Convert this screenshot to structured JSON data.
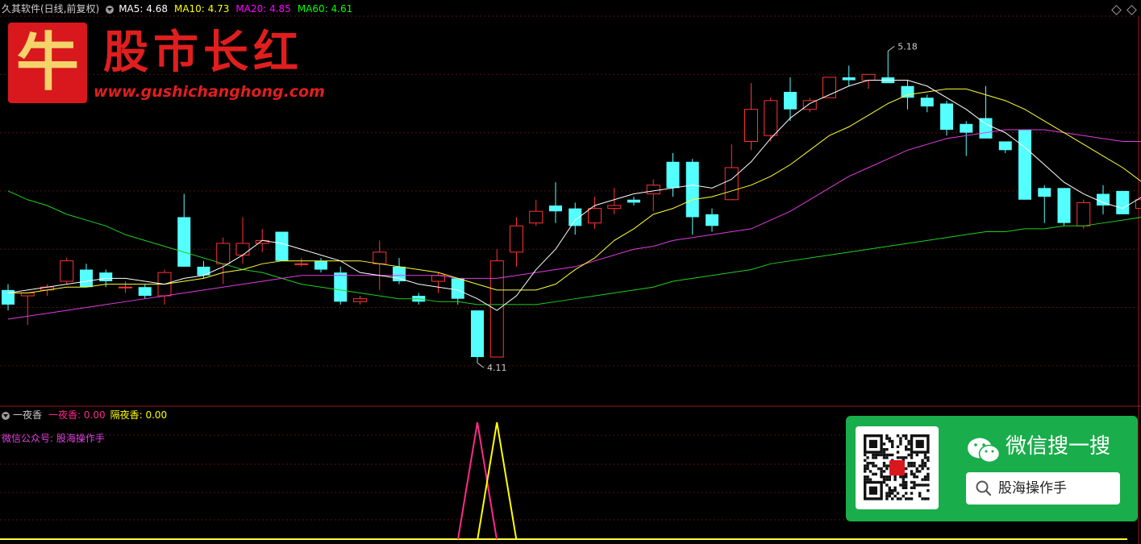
{
  "header": {
    "title": "久其软件(日线,前复权)",
    "indicators": [
      {
        "label": "MA5:",
        "value": "4.68",
        "color": "#ffffff"
      },
      {
        "label": "MA10:",
        "value": "4.73",
        "color": "#ffff00"
      },
      {
        "label": "MA20:",
        "value": "4.85",
        "color": "#ff00ff"
      },
      {
        "label": "MA60:",
        "value": "4.61",
        "color": "#00ff00"
      }
    ]
  },
  "chart_data": {
    "type": "candlestick",
    "price_range": [
      4.0,
      5.3
    ],
    "high_label": "5.18",
    "low_label": "4.11",
    "candles": [
      [
        4.36,
        4.31,
        4.38,
        4.29
      ],
      [
        4.34,
        4.35,
        4.35,
        4.24
      ],
      [
        4.36,
        4.37,
        4.38,
        4.34
      ],
      [
        4.39,
        4.46,
        4.47,
        4.38
      ],
      [
        4.43,
        4.37,
        4.45,
        4.37
      ],
      [
        4.42,
        4.39,
        4.43,
        4.37
      ],
      [
        4.37,
        4.37,
        4.39,
        4.35
      ],
      [
        4.37,
        4.34,
        4.38,
        4.33
      ],
      [
        4.34,
        4.42,
        4.43,
        4.31
      ],
      [
        4.61,
        4.44,
        4.69,
        4.44
      ],
      [
        4.44,
        4.41,
        4.46,
        4.4
      ],
      [
        4.45,
        4.52,
        4.54,
        4.38
      ],
      [
        4.48,
        4.52,
        4.61,
        4.45
      ],
      [
        4.52,
        4.53,
        4.57,
        4.49
      ],
      [
        4.56,
        4.46,
        4.56,
        4.46
      ],
      [
        4.45,
        4.45,
        4.47,
        4.44
      ],
      [
        4.46,
        4.43,
        4.47,
        4.42
      ],
      [
        4.42,
        4.32,
        4.44,
        4.31
      ],
      [
        4.32,
        4.33,
        4.34,
        4.31
      ],
      [
        4.45,
        4.49,
        4.53,
        4.36
      ],
      [
        4.44,
        4.39,
        4.47,
        4.38
      ],
      [
        4.34,
        4.32,
        4.35,
        4.31
      ],
      [
        4.39,
        4.41,
        4.42,
        4.35
      ],
      [
        4.4,
        4.33,
        4.4,
        4.31
      ],
      [
        4.29,
        4.13,
        4.29,
        4.11
      ],
      [
        4.13,
        4.46,
        4.5,
        4.13
      ],
      [
        4.49,
        4.58,
        4.61,
        4.44
      ],
      [
        4.59,
        4.63,
        4.67,
        4.58
      ],
      [
        4.65,
        4.63,
        4.73,
        4.59
      ],
      [
        4.64,
        4.58,
        4.66,
        4.55
      ],
      [
        4.59,
        4.64,
        4.68,
        4.57
      ],
      [
        4.64,
        4.65,
        4.71,
        4.62
      ],
      [
        4.67,
        4.66,
        4.68,
        4.65
      ],
      [
        4.69,
        4.72,
        4.74,
        4.63
      ],
      [
        4.8,
        4.71,
        4.83,
        4.68
      ],
      [
        4.8,
        4.61,
        4.81,
        4.55
      ],
      [
        4.62,
        4.58,
        4.64,
        4.56
      ],
      [
        4.67,
        4.78,
        4.86,
        4.67
      ],
      [
        4.87,
        4.98,
        5.07,
        4.84
      ],
      [
        4.89,
        5.01,
        5.02,
        4.87
      ],
      [
        5.04,
        4.98,
        5.09,
        4.94
      ],
      [
        4.98,
        5.01,
        5.02,
        4.97
      ],
      [
        5.02,
        5.09,
        5.09,
        5.03
      ],
      [
        5.09,
        5.08,
        5.13,
        5.06
      ],
      [
        5.08,
        5.1,
        5.1,
        5.05
      ],
      [
        5.09,
        5.07,
        5.18,
        5.09
      ],
      [
        5.06,
        5.02,
        5.08,
        4.98
      ],
      [
        5.02,
        4.99,
        5.03,
        4.97
      ],
      [
        5.0,
        4.91,
        5.01,
        4.89
      ],
      [
        4.93,
        4.9,
        4.94,
        4.82
      ],
      [
        4.95,
        4.88,
        5.06,
        4.88
      ],
      [
        4.87,
        4.84,
        4.87,
        4.83
      ],
      [
        4.91,
        4.67,
        4.91,
        4.67
      ],
      [
        4.71,
        4.68,
        4.72,
        4.59
      ],
      [
        4.71,
        4.59,
        4.71,
        4.58
      ],
      [
        4.58,
        4.66,
        4.67,
        4.57
      ],
      [
        4.69,
        4.65,
        4.72,
        4.62
      ],
      [
        4.7,
        4.62,
        4.7,
        4.62
      ],
      [
        4.64,
        4.67,
        4.71,
        4.63
      ]
    ],
    "ma5": [
      4.35,
      4.36,
      4.37,
      4.38,
      4.39,
      4.4,
      4.4,
      4.39,
      4.38,
      4.4,
      4.41,
      4.44,
      4.48,
      4.53,
      4.52,
      4.5,
      4.48,
      4.46,
      4.42,
      4.41,
      4.4,
      4.38,
      4.37,
      4.36,
      4.33,
      4.29,
      4.34,
      4.43,
      4.5,
      4.6,
      4.65,
      4.67,
      4.69,
      4.7,
      4.71,
      4.72,
      4.71,
      4.74,
      4.8,
      4.88,
      4.95,
      5.0,
      5.03,
      5.06,
      5.08,
      5.08,
      5.08,
      5.06,
      5.02,
      4.98,
      4.93,
      4.9,
      4.85,
      4.79,
      4.73,
      4.69,
      4.66,
      4.64,
      4.68
    ],
    "ma10": [
      4.35,
      4.35,
      4.36,
      4.37,
      4.37,
      4.38,
      4.38,
      4.38,
      4.38,
      4.39,
      4.4,
      4.42,
      4.43,
      4.45,
      4.46,
      4.46,
      4.46,
      4.46,
      4.46,
      4.45,
      4.44,
      4.43,
      4.42,
      4.4,
      4.38,
      4.36,
      4.36,
      4.36,
      4.38,
      4.43,
      4.47,
      4.53,
      4.57,
      4.62,
      4.64,
      4.67,
      4.68,
      4.7,
      4.72,
      4.75,
      4.79,
      4.84,
      4.89,
      4.92,
      4.96,
      5.0,
      5.03,
      5.04,
      5.05,
      5.05,
      5.03,
      5.01,
      4.98,
      4.94,
      4.9,
      4.86,
      4.82,
      4.78,
      4.73
    ],
    "ma20": [
      4.26,
      4.27,
      4.28,
      4.29,
      4.3,
      4.31,
      4.32,
      4.33,
      4.34,
      4.35,
      4.36,
      4.37,
      4.38,
      4.39,
      4.4,
      4.41,
      4.41,
      4.41,
      4.41,
      4.41,
      4.41,
      4.41,
      4.41,
      4.4,
      4.4,
      4.4,
      4.41,
      4.42,
      4.43,
      4.44,
      4.46,
      4.48,
      4.5,
      4.51,
      4.53,
      4.54,
      4.55,
      4.56,
      4.57,
      4.6,
      4.63,
      4.67,
      4.71,
      4.75,
      4.78,
      4.81,
      4.84,
      4.86,
      4.88,
      4.89,
      4.9,
      4.91,
      4.91,
      4.91,
      4.9,
      4.89,
      4.88,
      4.87,
      4.87
    ],
    "ma60": [
      4.7,
      4.67,
      4.65,
      4.62,
      4.6,
      4.58,
      4.55,
      4.53,
      4.51,
      4.49,
      4.47,
      4.45,
      4.43,
      4.42,
      4.4,
      4.38,
      4.37,
      4.36,
      4.35,
      4.34,
      4.33,
      4.33,
      4.32,
      4.32,
      4.31,
      4.31,
      4.31,
      4.31,
      4.32,
      4.33,
      4.34,
      4.35,
      4.36,
      4.37,
      4.39,
      4.4,
      4.41,
      4.42,
      4.43,
      4.45,
      4.46,
      4.47,
      4.48,
      4.49,
      4.5,
      4.51,
      4.52,
      4.53,
      4.54,
      4.55,
      4.56,
      4.56,
      4.57,
      4.57,
      4.58,
      4.58,
      4.59,
      4.6,
      4.61
    ]
  },
  "sub_chart": {
    "name": "一夜香",
    "series": [
      {
        "label": "一夜香:",
        "value": "0.00",
        "color": "#ff2a8a",
        "spike_index": 24
      },
      {
        "label": "隔夜香:",
        "value": "0.00",
        "color": "#ffff00",
        "spike_index": 25
      }
    ],
    "note": "微信公众号: 股海操作手"
  },
  "logo": {
    "char": "牛",
    "title": "股市长红",
    "url": "www.gushichanghong.com"
  },
  "wechat": {
    "title": "微信搜一搜",
    "search_text": "股海操作手"
  },
  "colors": {
    "up": "#ff3333",
    "down": "#54ffff",
    "grid": "#5a1010"
  }
}
